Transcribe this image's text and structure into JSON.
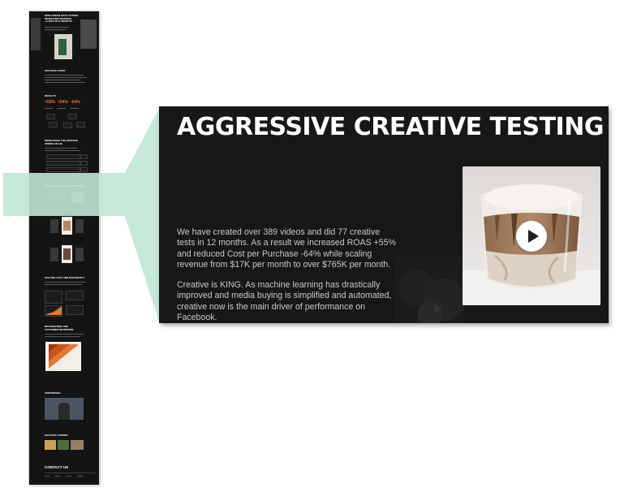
{
  "thumbnail": {
    "hero_title": "HOW URBAN GOAT COFFEE\nINCREASED REVENUE\n+4,400% IN 12 MONTHS",
    "sections": [
      "SUCCESS STORY",
      "RESULTS",
      "INCREASING THE AVERAGE\nORDER VALUE",
      "AGGRESSIVE CREATIVE TESTING",
      "SCALING FAST AND EFFICIENTLY",
      "RETARGETING AND\nCUSTOMER RETENTION",
      "TESTIMONIAL",
      "SUCCESS STORIES"
    ],
    "results": [
      "+55%",
      "+54%",
      "-64%"
    ],
    "contact_label": "CONTACT US"
  },
  "panel": {
    "heading": "AGGRESSIVE CREATIVE TESTING",
    "paragraph1": "We have created over 389 videos and did 77 creative tests in 12 months. As a result we increased ROAS +55% and reduced Cost per Purchase -64% while scaling revenue from $17K per month to over $765K per month.",
    "paragraph2": "Creative is KING. As machine learning has drastically improved and media buying is simplified and automated, creative now is the main driver of performance on Facebook."
  },
  "colors": {
    "page_bg": "#141414",
    "highlight": "#bfe6d3",
    "accent_orange": "#e8792c",
    "heading": "#ffffff",
    "body_text": "#c9c9c9"
  },
  "icons": {
    "play": "play-icon",
    "arrow": "arrow-right-icon"
  }
}
